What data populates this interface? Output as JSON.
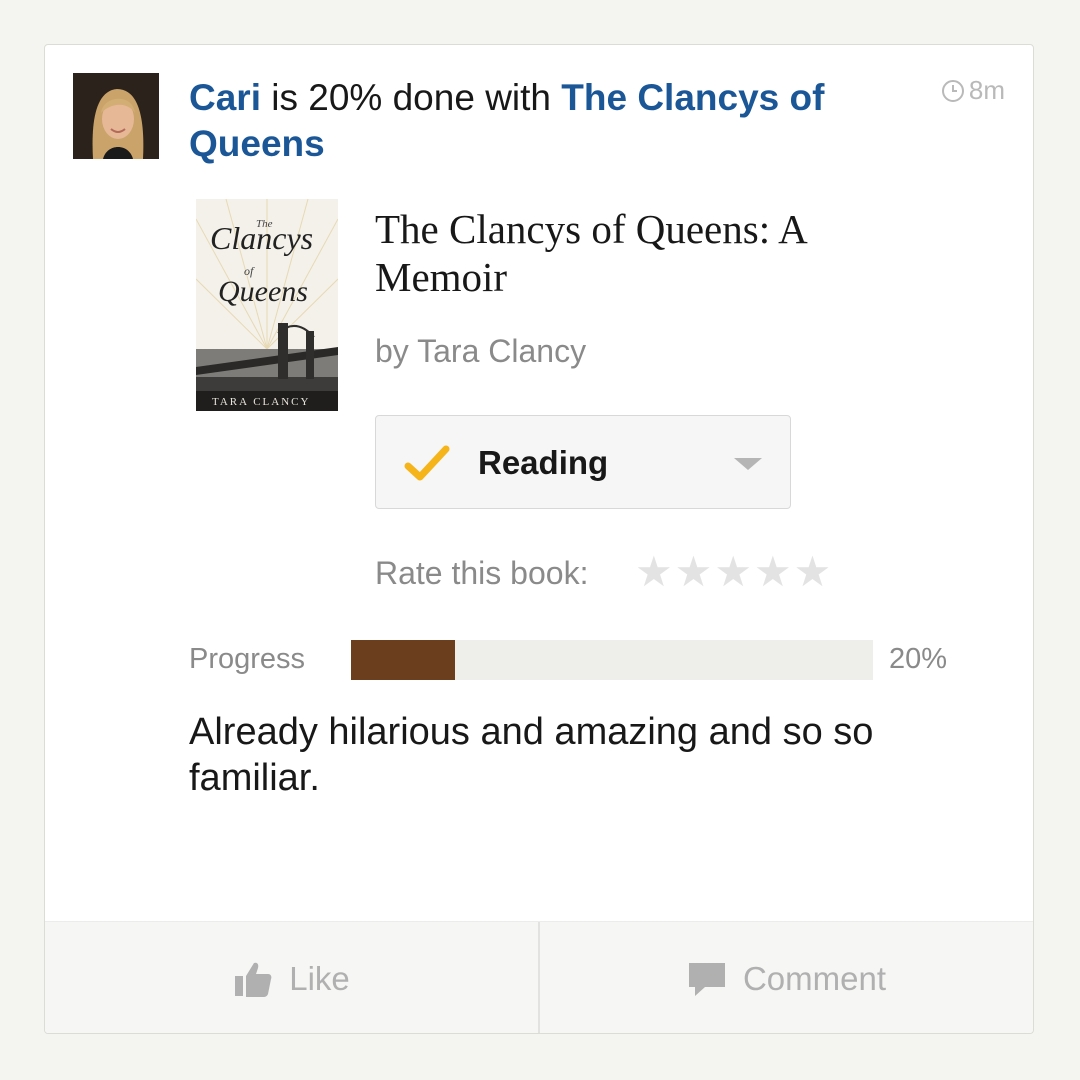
{
  "update": {
    "user_name": "Cari",
    "status_middle": " is 20% done with ",
    "book_link": "The Clancys of Queens",
    "timestamp": "8m"
  },
  "book": {
    "title": "The Clancys of Queens: A Memoir",
    "author_line": "by Tara Clancy",
    "cover": {
      "title_word1": "Clancys",
      "title_word2": "Queens",
      "small_the": "The",
      "small_of": "of",
      "author": "TARA CLANCY"
    }
  },
  "shelf": {
    "label": "Reading",
    "check_color": "#f5b41a"
  },
  "rating": {
    "label": "Rate this book:",
    "stars_total": 5,
    "stars_filled": 0
  },
  "progress": {
    "label": "Progress",
    "percent_text": "20%",
    "fraction": 0.2,
    "fill_color": "#6b3f1e"
  },
  "comment": "Already hilarious and amazing and so so familiar.",
  "actions": {
    "like_label": "Like",
    "comment_label": "Comment"
  },
  "colors": {
    "link": "#1b5797",
    "muted": "#8a8a8a"
  }
}
